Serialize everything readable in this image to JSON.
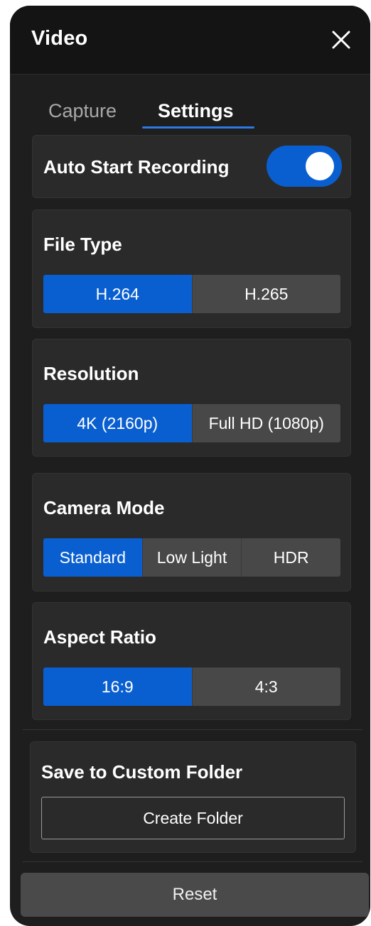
{
  "header": {
    "title": "Video",
    "close_icon": "close-icon"
  },
  "tabs": [
    {
      "label": "Capture",
      "active": false
    },
    {
      "label": "Settings",
      "active": true
    }
  ],
  "auto_start": {
    "label": "Auto Start Recording",
    "enabled": true
  },
  "file_type": {
    "label": "File Type",
    "options": [
      "H.264",
      "H.265"
    ],
    "selected": "H.264"
  },
  "resolution": {
    "label": "Resolution",
    "options": [
      "4K (2160p)",
      "Full HD (1080p)"
    ],
    "selected": "4K (2160p)"
  },
  "camera_mode": {
    "label": "Camera Mode",
    "options": [
      "Standard",
      "Low Light",
      "HDR"
    ],
    "selected": "Standard"
  },
  "aspect_ratio": {
    "label": "Aspect Ratio",
    "options": [
      "16:9",
      "4:3"
    ],
    "selected": "16:9"
  },
  "custom_folder": {
    "label": "Save to Custom Folder",
    "button_label": "Create Folder"
  },
  "footer": {
    "reset_label": "Reset"
  },
  "colors": {
    "accent": "#0a5fd0",
    "tab_underline": "#2b7ae6",
    "panel_bg": "#1e1e1e",
    "card_bg": "#2a2a2a"
  }
}
